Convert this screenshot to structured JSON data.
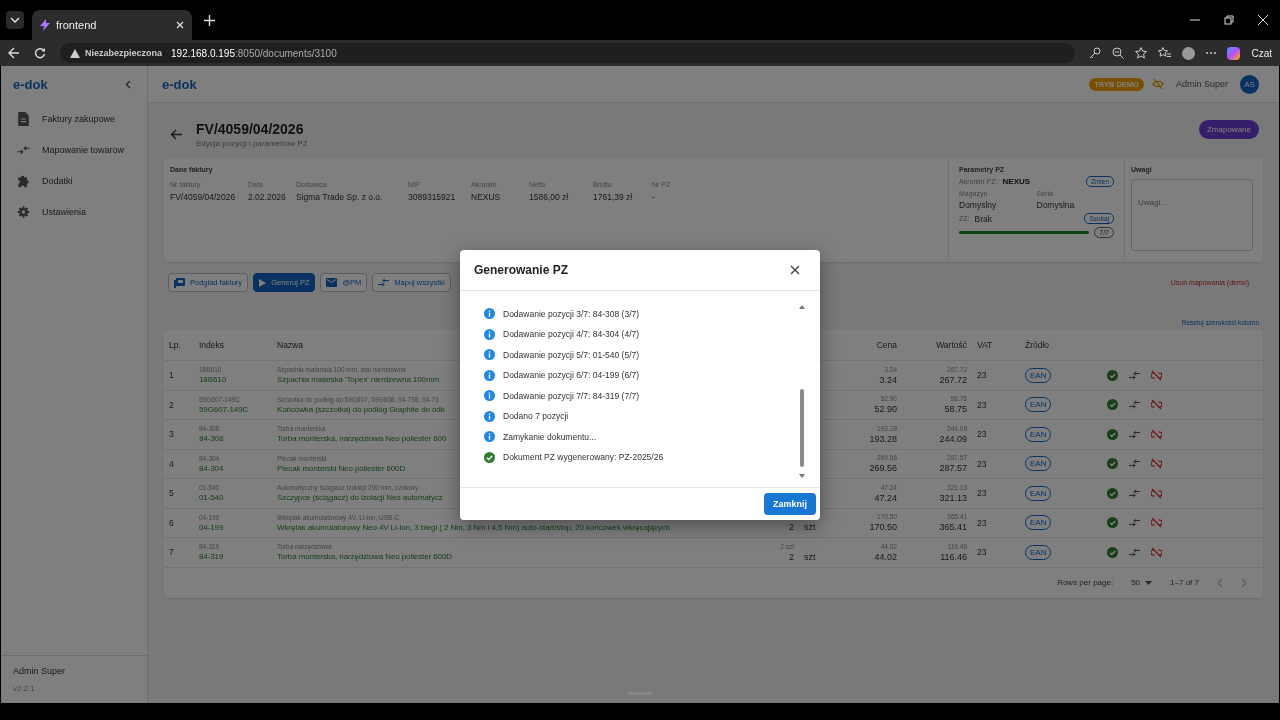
{
  "browser": {
    "tab_title": "frontend",
    "security_label": "Niezabezpieczona",
    "url_host": "192.168.0.195",
    "url_path": ":8050/documents/3100",
    "profile_label": "Czat"
  },
  "sidebar": {
    "logo": "e-dok",
    "items": [
      {
        "label": "Faktury zakupowe",
        "kind": "document",
        "selected": false
      },
      {
        "label": "Mapowanie towarow",
        "kind": "mapping",
        "selected": false
      },
      {
        "label": "Dodatki",
        "kind": "puzzle",
        "selected": false
      },
      {
        "label": "Ustawienia",
        "kind": "settings",
        "selected": false
      }
    ],
    "user": "Admin Super",
    "version": "v2.2.1"
  },
  "header": {
    "title": "e-dok",
    "demo_badge": "TRYB DEMO",
    "user_name": "Admin Super",
    "avatar": "AS"
  },
  "document": {
    "number": "FV/4059/04/2026",
    "subtitle": "Edycja pozycji i parametrow PZ",
    "status": "Zmapowane"
  },
  "invoice": {
    "heading": "Dane faktury",
    "fields": [
      {
        "label": "Nr faktury",
        "value": "FV/4059/04/2026"
      },
      {
        "label": "Data",
        "value": "2.02.2026"
      },
      {
        "label": "Dostawca",
        "value": "Sigma Trade Sp. z o.o."
      },
      {
        "label": "NIP",
        "value": "3089315921"
      },
      {
        "label": "Akronim",
        "value": "NEXUS"
      },
      {
        "label": "Netto",
        "value": "1586,00 zł"
      },
      {
        "label": "Brutto",
        "value": "1761,39 zł"
      },
      {
        "label": "Nr PZ",
        "value": "-"
      }
    ]
  },
  "pz_params": {
    "heading": "Parametry PZ",
    "akronim_label": "Akronim PZ:",
    "akronim_value": "NEXUS",
    "change_button": "Zmien",
    "warehouse_label": "Magazyn",
    "warehouse_value": "Domyslny",
    "series_label": "Seria",
    "series_value": "Domyslna",
    "zz_label": "ZZ:",
    "zz_value": "Brak",
    "search_button": "Szukaj",
    "level": 1,
    "progress_text": "7/7"
  },
  "notes": {
    "heading": "Uwagi",
    "placeholder": "Uwagi..."
  },
  "actions": [
    {
      "label": "Podglad faktury",
      "kind": "preview",
      "primary": false
    },
    {
      "label": "Generuj PZ",
      "kind": "play",
      "primary": true
    },
    {
      "label": "@PM",
      "kind": "mail",
      "primary": false
    },
    {
      "label": "Mapuj wszystki",
      "kind": "swap",
      "primary": false
    }
  ],
  "remove_mappings_link": "Usuń mapowania (demo)",
  "reset_columns_link": "Resetuj szerokości kolumn",
  "table": {
    "columns": [
      "Lp.",
      "Indeks",
      "Nazwa",
      "Cena",
      "Wartość",
      "VAT",
      "Źródło"
    ],
    "rows": [
      {
        "lp": "1",
        "index_sub": "18B610",
        "index": "18B610",
        "name_sub": "Szpachla malarska 100 mm, stal nierdzewna",
        "name": "Szpachla malarska 'Topex' nierdzewna 100mm",
        "price_sub": "3.24",
        "price": "3.24",
        "value_sub": "267.72",
        "value": "267.72",
        "vat": "23",
        "source": "EAN"
      },
      {
        "lp": "2",
        "index_sub": "59G607-149C",
        "index": "59G607-149C",
        "name_sub": "Szczotka do podłóg do 59G607, 59G608, 04-738, 04-73",
        "name": "Końcówka (szczotka) do podłóg Graphite do odk",
        "price_sub": "52.90",
        "price": "52.90",
        "value_sub": "58.75",
        "value": "58.75",
        "vat": "23",
        "source": "EAN"
      },
      {
        "lp": "3",
        "index_sub": "84-308",
        "index": "84-308",
        "name_sub": "Torba monterska",
        "name": "Torba monterska, narzędziowa Neo poliester 600",
        "price_sub": "193.28",
        "price": "193.28",
        "value_sub": "244.09",
        "value": "244.09",
        "vat": "23",
        "source": "EAN"
      },
      {
        "lp": "4",
        "index_sub": "84-304",
        "index": "84-304",
        "name_sub": "Plecak monterski",
        "name": "Plecak monterski Neo poliester 600D",
        "price_sub": "269.56",
        "price": "269.56",
        "value_sub": "287.57",
        "value": "287.57",
        "vat": "23",
        "source": "EAN"
      },
      {
        "lp": "5",
        "index_sub": "01-540",
        "index": "01-540",
        "name_sub": "Automatyczny ściągacz izolacji 200 mm, czołowy",
        "name": "Szczypce (ściągacz) do izolacji Neo automatycz",
        "price_sub": "47.24",
        "price": "47.24",
        "value_sub": "321.13",
        "value": "321.13",
        "vat": "23",
        "source": "EAN"
      },
      {
        "lp": "6",
        "index_sub": "04-199",
        "index": "04-199",
        "name_sub": "Wkrętak akumulatorowy 4V, Li-Ion, USB-C",
        "name": "Wkrętak akumulatorowy Neo 4V Li-Ion, 3 biegi ( 2 Nm, 3 Nm i 4,5 Nm) auto-start/stop, 20 końcówek wkręcających",
        "qty": "2",
        "unit": "szt",
        "price_sub": "170.50",
        "price": "170.50",
        "value_sub": "365.41",
        "value": "365.41",
        "vat": "23",
        "source": "EAN"
      },
      {
        "lp": "7",
        "index_sub": "84-319",
        "index": "84-319",
        "name_sub": "Torba narzędziowa",
        "name": "Torba monterska, narzędziowa Neo poliester 600D",
        "qty_sub": "2 szt",
        "qty": "2",
        "unit": "szt",
        "price_sub": "44.02",
        "price": "44.02",
        "value_sub": "116.46",
        "value": "116.46",
        "vat": "23",
        "source": "EAN"
      }
    ]
  },
  "pagination": {
    "rows_label": "Rows per page:",
    "rows_value": "50",
    "range": "1–7 of 7"
  },
  "dialog": {
    "title": "Generowanie PZ",
    "entries": [
      {
        "kind": "info",
        "text": "Dodawanie pozycji 3/7: 84-308 (3/7)"
      },
      {
        "kind": "info",
        "text": "Dodawanie pozycji 4/7: 84-304 (4/7)"
      },
      {
        "kind": "info",
        "text": "Dodawanie pozycji 5/7: 01-540 (5/7)"
      },
      {
        "kind": "info",
        "text": "Dodawanie pozycji 6/7: 04-199 (6/7)"
      },
      {
        "kind": "info",
        "text": "Dodawanie pozycji 7/7: 84-319 (7/7)"
      },
      {
        "kind": "info",
        "text": "Dodano 7 pozycji"
      },
      {
        "kind": "info",
        "text": "Zamykanie dokumentu..."
      },
      {
        "kind": "success",
        "text": "Dokument PZ wygenerowany: PZ-2025/26"
      }
    ],
    "close_button": "Zamknij"
  }
}
